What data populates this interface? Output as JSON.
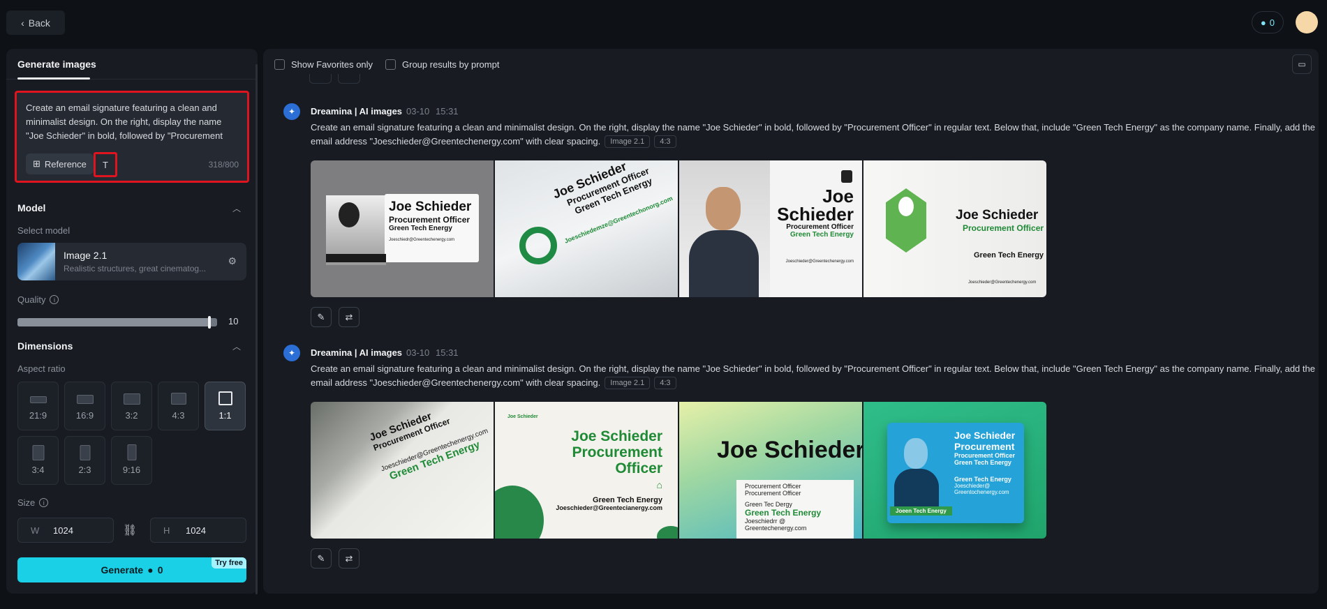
{
  "header": {
    "back_label": "Back",
    "credits": "0"
  },
  "left_panel": {
    "tab_label": "Generate images",
    "prompt_text": "Create an email signature featuring a clean and minimalist design. On the right, display the name \"Joe Schieder\" in bold, followed by \"Procurement Officer\" in regular text. Below that, include \"Green Tech Energy\" as the company name. Finally, add the email address \"Joeschieder@Greentechenergy.com\" with clear spacing.",
    "reference_label": "Reference",
    "text_tool_label": "T",
    "counter": "318/800",
    "model": {
      "section_title": "Model",
      "select_label": "Select model",
      "name": "Image 2.1",
      "description": "Realistic structures, great cinematog...",
      "quality_label": "Quality",
      "quality_value": "10",
      "quality_fraction": 0.96
    },
    "dimensions": {
      "section_title": "Dimensions",
      "aspect_label": "Aspect ratio",
      "ratios": [
        "21:9",
        "16:9",
        "3:2",
        "4:3",
        "1:1",
        "3:4",
        "2:3",
        "9:16"
      ],
      "selected_ratio": "1:1",
      "size_label": "Size",
      "width_prefix": "W",
      "width": "1024",
      "height_prefix": "H",
      "height": "1024"
    },
    "generate": {
      "label": "Generate",
      "cost": "0",
      "badge": "Try free"
    }
  },
  "main": {
    "filters": {
      "favorites": "Show Favorites only",
      "group": "Group results by prompt"
    },
    "groups": [
      {
        "author": "Dreamina | AI images",
        "date": "03-10",
        "time": "15:31",
        "prompt": "Create an email signature featuring a clean and minimalist design. On the right, display the name \"Joe Schieder\" in bold, followed by \"Procurement Officer\" in regular text. Below that, include \"Green Tech Energy\" as the company name. Finally, add the email address \"Joeschieder@Greentechenergy.com\" with clear spacing.",
        "model_tag": "Image 2.1",
        "ratio_tag": "4:3"
      },
      {
        "author": "Dreamina | AI images",
        "date": "03-10",
        "time": "15:31",
        "prompt": "Create an email signature featuring a clean and minimalist design. On the right, display the name \"Joe Schieder\" in bold, followed by \"Procurement Officer\" in regular text. Below that, include \"Green Tech Energy\" as the company name. Finally, add the email address \"Joeschieder@Greentechenergy.com\" with clear spacing.",
        "model_tag": "Image 2.1",
        "ratio_tag": "4:3"
      }
    ],
    "card_texts": {
      "g1_img1": {
        "name": "Joe Schieder",
        "title": "Procurement Officer",
        "company": "Green Tech Energy",
        "email": "Joeschiedr@Greentechenergy.com"
      },
      "g1_img2": {
        "name": "Joe Schieder",
        "title": "Procurement Officer",
        "company": "Green Tech Energy",
        "email": "Joeschiedemze@Greentechonorg.com"
      },
      "g1_img3": {
        "first": "Joe",
        "last": "Schieder",
        "title": "Procurement Officer",
        "company": "Green Tech Energy",
        "email": "Joeschieder@Greentechenergy.com"
      },
      "g1_img4": {
        "name": "Joe Schieder",
        "title": "Procurement Officer",
        "company": "Green Tech Energy",
        "email": "Joeschieder@Greentechenergy.com"
      },
      "g2_img1": {
        "name": "Joe Schieder",
        "title": "Procurement Officer",
        "company": "Green Tech Energy",
        "email": "Joeschieder@Greentechenergy.com"
      },
      "g2_img2": {
        "logo": "Joe Schieder",
        "name": "Joe Schieder",
        "title1": "Procurement",
        "title2": "Officer",
        "company": "Green Tech Energy",
        "email": "Joeschieder@Greentecianergy.com"
      },
      "g2_img3": {
        "name": "Joe Schieder",
        "line1": "Procurement Officer",
        "line2": "Procurement Officer",
        "line3": "Green Tec Dergy",
        "company": "Green Tech Energy",
        "email": "Joeschiedrr @ Greentechenergy.com"
      },
      "g2_img4": {
        "name": "Joe Schieder",
        "title": "Procurement",
        "line1": "Procurement Officer",
        "line2": "Green Tech Energy",
        "company": "Green Tech Energy",
        "email1": "Joeschieder@",
        "email2": "Greentochenergy.com",
        "banner": "Joeen Tech Energy"
      }
    }
  }
}
